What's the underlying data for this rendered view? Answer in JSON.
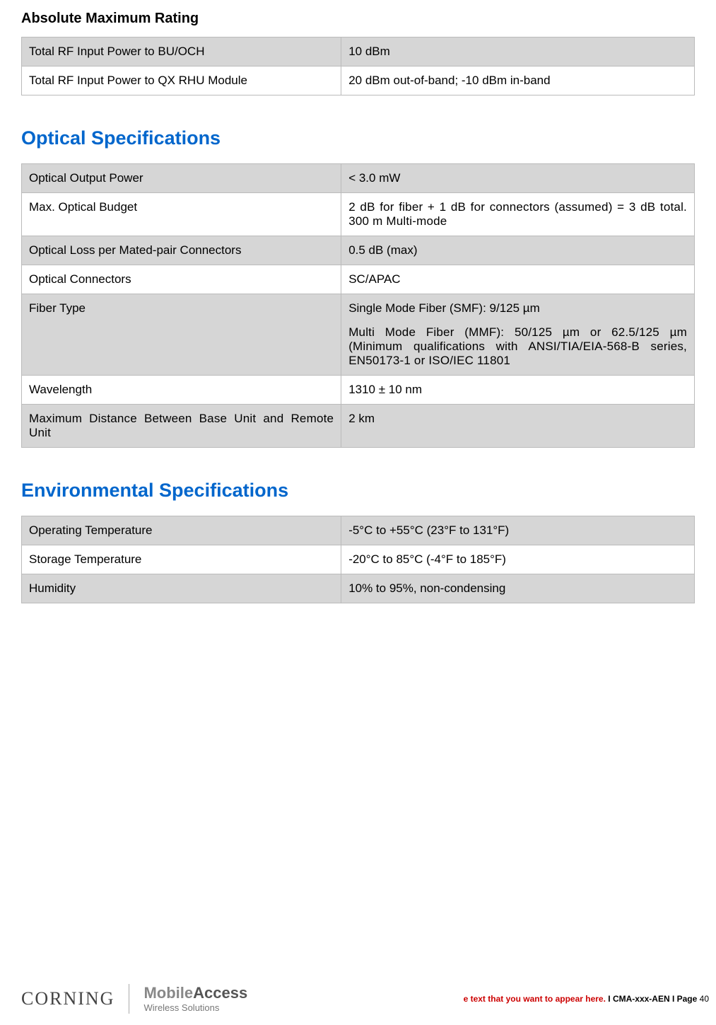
{
  "sections": {
    "abs_max": {
      "title": "Absolute Maximum Rating",
      "rows": [
        {
          "label": "Total RF Input Power to BU/OCH",
          "value": "10 dBm"
        },
        {
          "label": "Total RF Input Power to QX RHU Module",
          "value": "20 dBm out-of-band; -10 dBm in-band"
        }
      ]
    },
    "optical": {
      "title": "Optical Specifications",
      "rows": [
        {
          "label": "Optical Output Power",
          "value": "< 3.0 mW"
        },
        {
          "label": "Max. Optical Budget",
          "value": "2 dB for fiber + 1 dB for connectors (assumed) = 3 dB total. 300 m Multi-mode"
        },
        {
          "label": "Optical Loss per Mated-pair Connectors",
          "value": "0.5 dB (max)"
        },
        {
          "label": "Optical Connectors",
          "value": "SC/APAC"
        },
        {
          "label": "Fiber Type",
          "value_line1": "Single Mode Fiber (SMF): 9/125 µm",
          "value_line2": "Multi Mode Fiber (MMF): 50/125 µm or 62.5/125 µm (Minimum qualifications with ANSI/TIA/EIA-568-B series, EN50173-1 or ISO/IEC 11801"
        },
        {
          "label": "Wavelength",
          "value": "1310 ± 10 nm"
        },
        {
          "label": "Maximum Distance Between Base Unit and Remote Unit",
          "value": "2 km"
        }
      ]
    },
    "env": {
      "title": "Environmental Specifications",
      "rows": [
        {
          "label": "Operating Temperature",
          "value": "-5°C to +55°C (23°F to 131°F)"
        },
        {
          "label": "Storage Temperature",
          "value": "-20°C to 85°C (-4°F to 185°F)"
        },
        {
          "label": "Humidity",
          "value": "10% to 95%, non-condensing"
        }
      ]
    }
  },
  "footer": {
    "corning": "CORNING",
    "mobile": "Mobile",
    "access": "Access",
    "subtitle": "Wireless Solutions",
    "red_text": "e text that you want to appear here.",
    "doc_ref": " I CMA-xxx-AEN I Page ",
    "page_num": "40"
  }
}
